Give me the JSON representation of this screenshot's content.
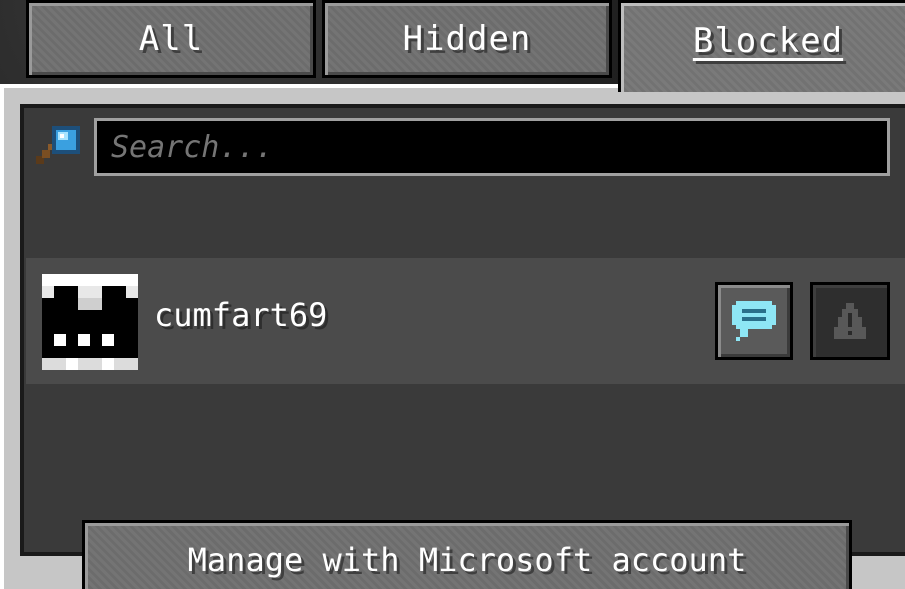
{
  "tabs": [
    {
      "label": "All"
    },
    {
      "label": "Hidden"
    },
    {
      "label": "Blocked",
      "selected": true
    }
  ],
  "search": {
    "placeholder": "Search...",
    "icon": "magnifying-glass-icon"
  },
  "players": [
    {
      "name": "cumfart69",
      "avatar": "player-skin-head",
      "actions": [
        {
          "icon": "chat-bubble-icon",
          "enabled": true
        },
        {
          "icon": "warning-icon",
          "enabled": false
        }
      ]
    }
  ],
  "footer": {
    "manage_label": "Manage with Microsoft account"
  },
  "colors": {
    "panel_light": "#c6c6c6",
    "list_bg": "#3a3a3a",
    "row_bg": "#4b4b4b",
    "button_bg": "#6f6f6f",
    "chat_icon": "#7fe0f0"
  }
}
